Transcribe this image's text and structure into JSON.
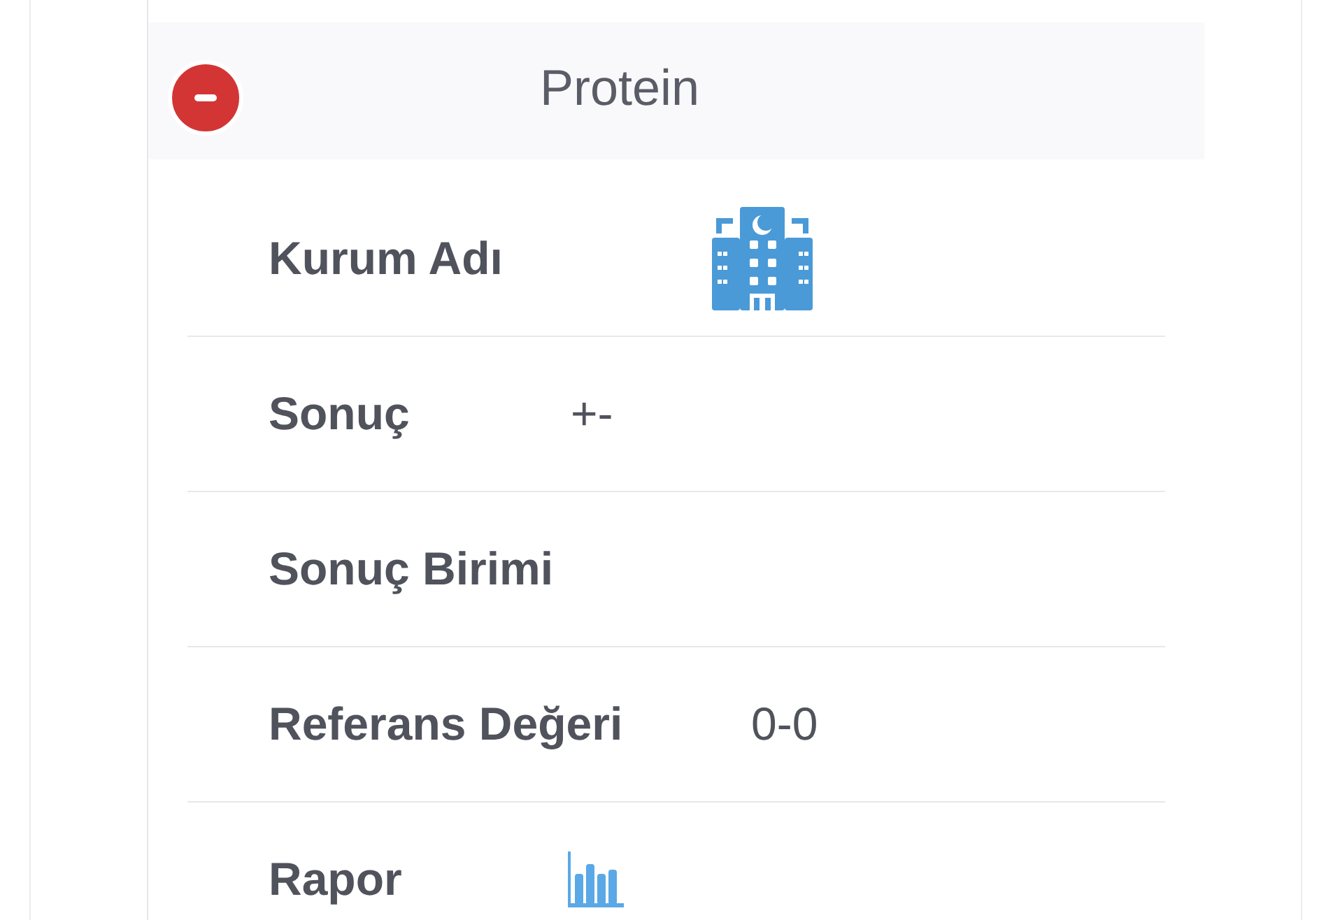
{
  "section": {
    "title": "Protein",
    "expanded": true
  },
  "rows": [
    {
      "label": "Kurum Adı",
      "kind": "building"
    },
    {
      "label": "Sonuç",
      "kind": "text",
      "value": "+-"
    },
    {
      "label": "Sonuç Birimi",
      "kind": "empty"
    },
    {
      "label": "Referans Değeri",
      "kind": "text",
      "value": "0-0"
    },
    {
      "label": "Rapor",
      "kind": "chart"
    }
  ]
}
